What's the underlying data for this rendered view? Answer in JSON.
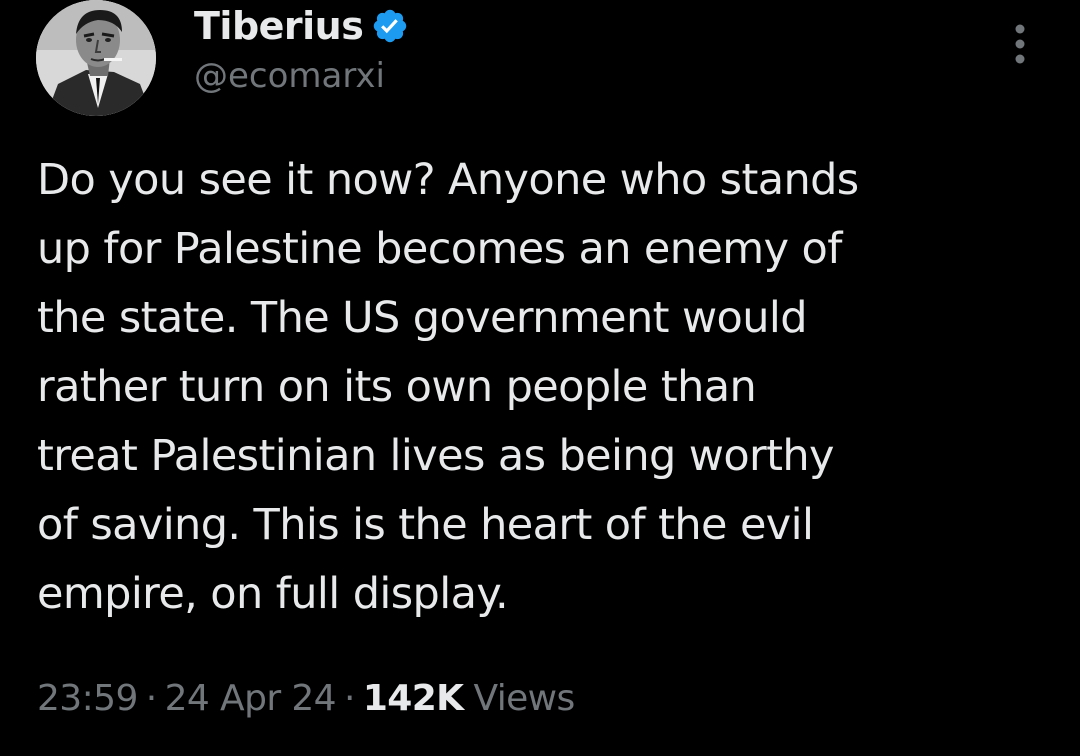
{
  "author": {
    "display_name": "Tiberius",
    "handle": "@ecomarxi",
    "verified": true,
    "verified_color": "#1d9bf0"
  },
  "tweet": {
    "text": "Do you see it now? Anyone who stands\nup for Palestine becomes an enemy of\nthe state. The US government would\nrather turn on its own people than\ntreat Palestinian lives as being worthy\nof saving. This is the heart of the evil\nempire, on full display."
  },
  "meta": {
    "time": "23:59",
    "date": "24 Apr 24",
    "separator": "·",
    "views_count": "142K",
    "views_label": "Views"
  },
  "icons": {
    "more": "more-vertical-icon",
    "verified": "verified-badge-icon"
  },
  "colors": {
    "background": "#000000",
    "primary_text": "#e7e9ea",
    "secondary_text": "#71767b"
  }
}
